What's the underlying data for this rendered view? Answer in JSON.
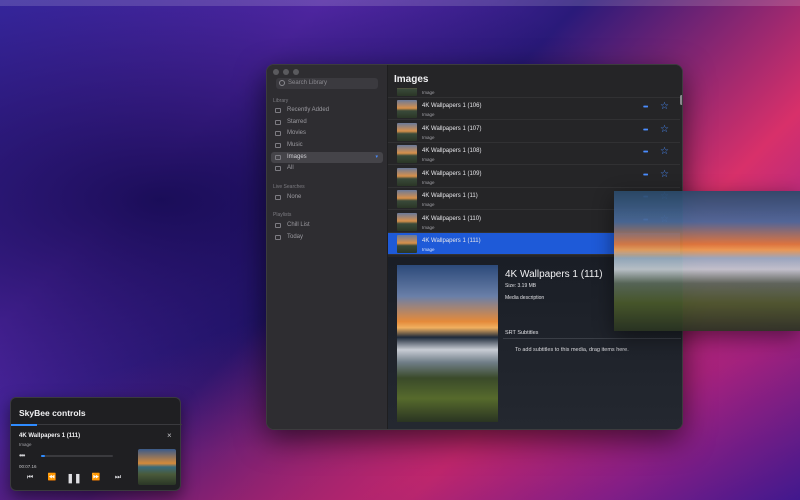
{
  "sidebar": {
    "search_placeholder": "Search Library",
    "library_heading": "Library",
    "library_items": [
      {
        "label": "Recently Added",
        "icon": "calendar-icon"
      },
      {
        "label": "Starred",
        "icon": "star-icon"
      },
      {
        "label": "Movies",
        "icon": "film-icon"
      },
      {
        "label": "Music",
        "icon": "music-icon"
      },
      {
        "label": "Images",
        "icon": "photo-icon",
        "active": true
      },
      {
        "label": "All",
        "icon": "grid-icon"
      }
    ],
    "live_searches_heading": "Live Searches",
    "live_searches_items": [
      {
        "label": "None",
        "icon": "gear-icon"
      }
    ],
    "playlists_heading": "Playlists",
    "playlists_items": [
      {
        "label": "Chill List",
        "icon": "list-icon"
      },
      {
        "label": "Today",
        "icon": "list-icon"
      }
    ]
  },
  "main": {
    "title": "Images",
    "rows": [
      {
        "title": "",
        "subtitle": "Image"
      },
      {
        "title": "4K Wallpapers 1 (106)",
        "subtitle": "Image"
      },
      {
        "title": "4K Wallpapers 1 (107)",
        "subtitle": "Image"
      },
      {
        "title": "4K Wallpapers 1 (108)",
        "subtitle": "Image"
      },
      {
        "title": "4K Wallpapers 1 (109)",
        "subtitle": "Image"
      },
      {
        "title": "4K Wallpapers 1 (11)",
        "subtitle": "Image"
      },
      {
        "title": "4K Wallpapers 1 (110)",
        "subtitle": "Image"
      },
      {
        "title": "4K Wallpapers 1 (111)",
        "subtitle": "Image",
        "selected": true
      }
    ],
    "more_glyph": "•••",
    "star_glyph": "☆"
  },
  "detail": {
    "title": "4K Wallpapers 1 (111)",
    "size": "Size: 3.19 MB",
    "description_label": "Media description",
    "srt_heading": "SRT Subtitles",
    "srt_hint": "To add subtitles to this media, drag items here."
  },
  "controls": {
    "title": "SkyBee controls",
    "track": "4K Wallpapers 1 (111)",
    "type": "Image",
    "time": "00:07.16",
    "more_glyph": "•••",
    "progress": 0.05,
    "close_glyph": "×",
    "buttons": [
      {
        "name": "skip-back-button",
        "glyph": "⏮"
      },
      {
        "name": "rewind-button",
        "glyph": "⏪"
      },
      {
        "name": "pause-button",
        "glyph": "❚❚"
      },
      {
        "name": "fast-forward-button",
        "glyph": "⏩"
      },
      {
        "name": "skip-forward-button",
        "glyph": "⏭"
      }
    ]
  },
  "colors": {
    "accent": "#1e5ad8",
    "link": "#4a8dff"
  }
}
